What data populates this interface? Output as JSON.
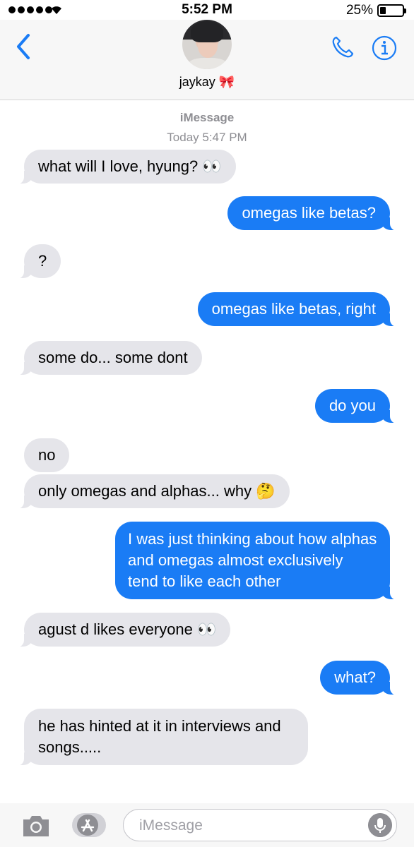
{
  "status_bar": {
    "time": "5:52 PM",
    "battery": "25%"
  },
  "header": {
    "contact_name": "jaykay 🎀"
  },
  "thread": {
    "service": "iMessage",
    "timestamp": "Today 5:47 PM",
    "messages": [
      {
        "from": "them",
        "text": "what will I love, hyung? 👀"
      },
      {
        "from": "me",
        "text": "omegas like betas?"
      },
      {
        "from": "them",
        "text": "?"
      },
      {
        "from": "me",
        "text": "omegas like betas, right"
      },
      {
        "from": "them",
        "text": "some do... some dont"
      },
      {
        "from": "me",
        "text": "do you"
      },
      {
        "from": "them",
        "text": "no"
      },
      {
        "from": "them",
        "text": "only omegas and alphas... why 🤔"
      },
      {
        "from": "me",
        "text": "I was just thinking about how alphas and omegas almost exclusively tend to like each other"
      },
      {
        "from": "them",
        "text": "agust d likes everyone 👀"
      },
      {
        "from": "me",
        "text": "what?"
      },
      {
        "from": "them",
        "text": "he has hinted at it in interviews and songs....."
      }
    ]
  },
  "composer": {
    "placeholder": "iMessage"
  },
  "colors": {
    "sent_bubble": "#1a7cf5",
    "received_bubble": "#e5e5ea",
    "accent": "#1a7cf5"
  },
  "icons": [
    "back-chevron-icon",
    "phone-icon",
    "info-icon",
    "camera-icon",
    "app-store-icon",
    "microphone-icon",
    "wifi-icon"
  ]
}
